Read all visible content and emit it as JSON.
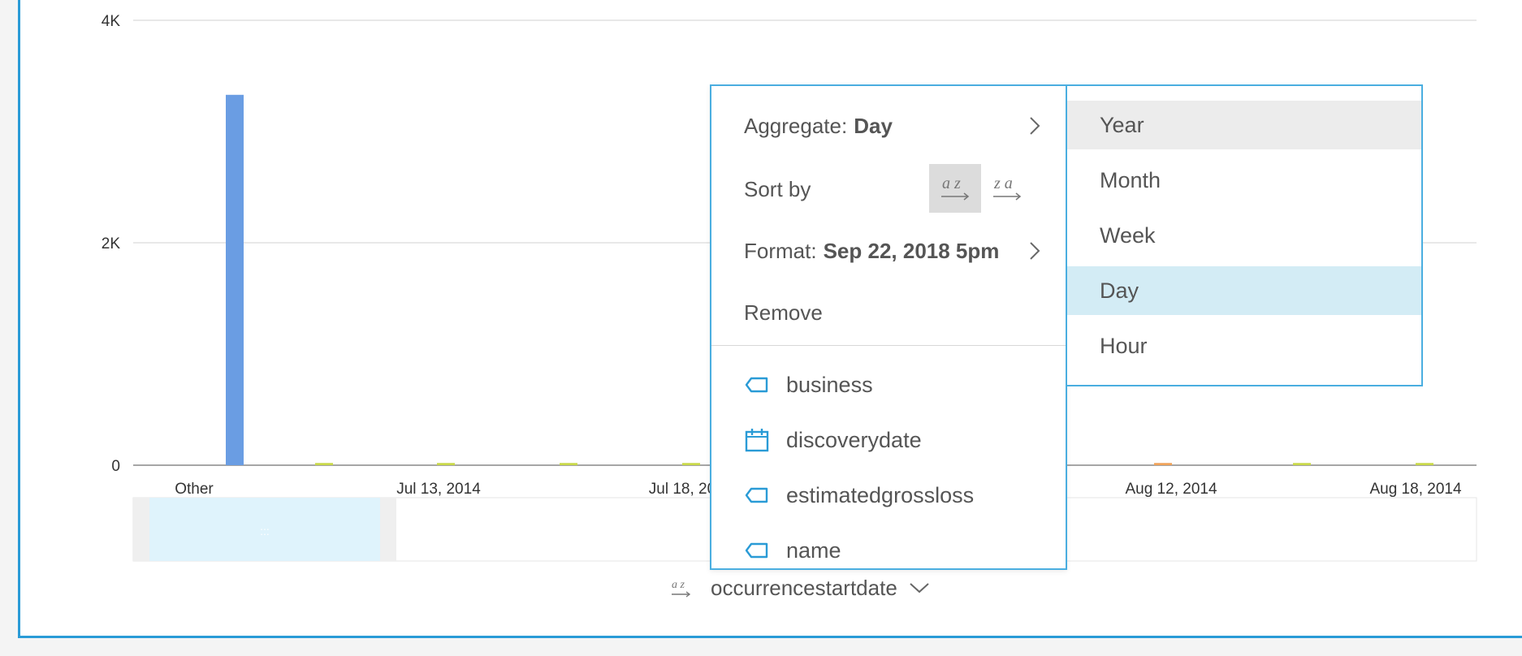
{
  "chart_data": {
    "type": "bar",
    "y_ticks": [
      "4K",
      "2K",
      "0"
    ],
    "ylim": [
      0,
      4000
    ],
    "x_tick_labels": [
      "Other",
      "Jul 13, 2014",
      "Jul 18, 20",
      "Aug 12, 2014",
      "Aug 18, 2014"
    ],
    "bars": [
      {
        "category": "Other",
        "value": 3330,
        "color": "#6a9de3"
      }
    ],
    "minor_bars": [
      {
        "value": 20,
        "color": "#c9d94a"
      },
      {
        "value": 20,
        "color": "#c9d94a"
      },
      {
        "value": 20,
        "color": "#c9d94a"
      },
      {
        "value": 20,
        "color": "#c9d94a"
      },
      {
        "value": 20,
        "color": "#f0a35a"
      },
      {
        "value": 20,
        "color": "#c9d94a"
      },
      {
        "value": 20,
        "color": "#c9d94a"
      }
    ],
    "grid": true
  },
  "axis_field": {
    "name": "occurrencestartdate",
    "sort_icon": "sort-az-icon",
    "chevron_icon": "chevron-down-icon"
  },
  "menu": {
    "aggregate_label": "Aggregate:",
    "aggregate_value": "Day",
    "sort_label": "Sort by",
    "sort_asc_icon": "sort-az-icon",
    "sort_desc_icon": "sort-za-icon",
    "format_label": "Format:",
    "format_value": "Sep 22, 2018 5pm",
    "remove_label": "Remove",
    "fields": [
      {
        "name": "business",
        "icon": "tag-icon"
      },
      {
        "name": "discoverydate",
        "icon": "calendar-icon"
      },
      {
        "name": "estimatedgrossloss",
        "icon": "tag-icon"
      },
      {
        "name": "name",
        "icon": "tag-icon"
      }
    ]
  },
  "aggregate_options": [
    "Year",
    "Month",
    "Week",
    "Day",
    "Hour"
  ],
  "aggregate_selected": "Day",
  "aggregate_hover": "Year",
  "colors": {
    "accent": "#2a9bd6",
    "bar": "#6a9de3",
    "selected": "#d3ecf5"
  }
}
